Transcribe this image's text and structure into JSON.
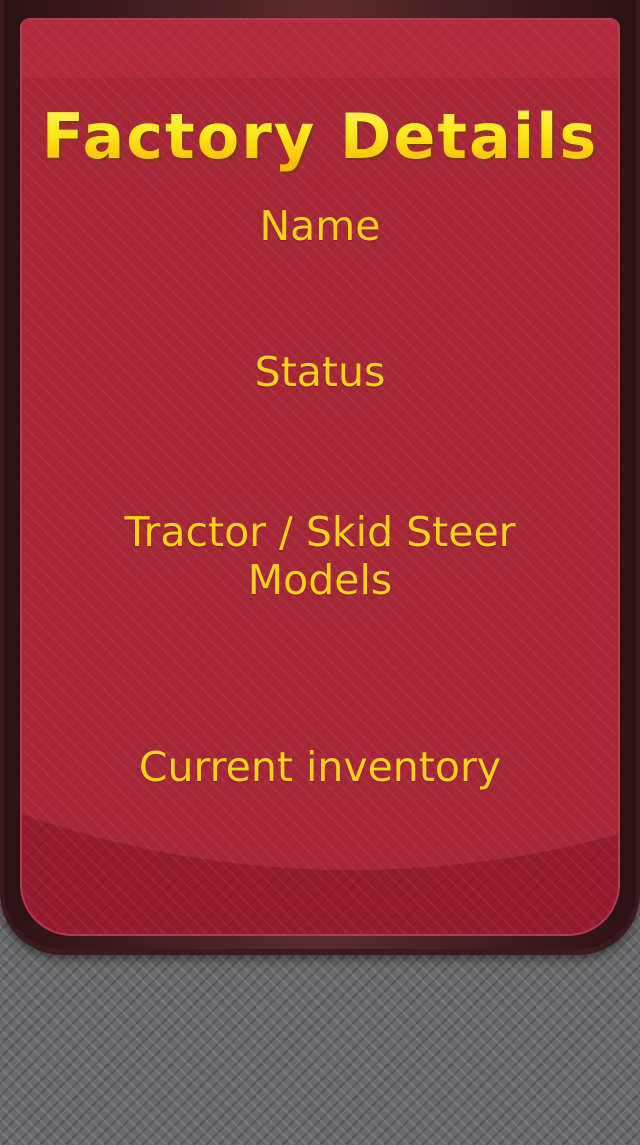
{
  "title": "Factory Details",
  "fields": {
    "name": "Name",
    "status": "Status",
    "models": "Tractor / Skid Steer Models",
    "inventory": "Current inventory"
  },
  "colors": {
    "panel": "#951b2e",
    "text": "#f7d21b",
    "background": "#6a6a6c"
  }
}
